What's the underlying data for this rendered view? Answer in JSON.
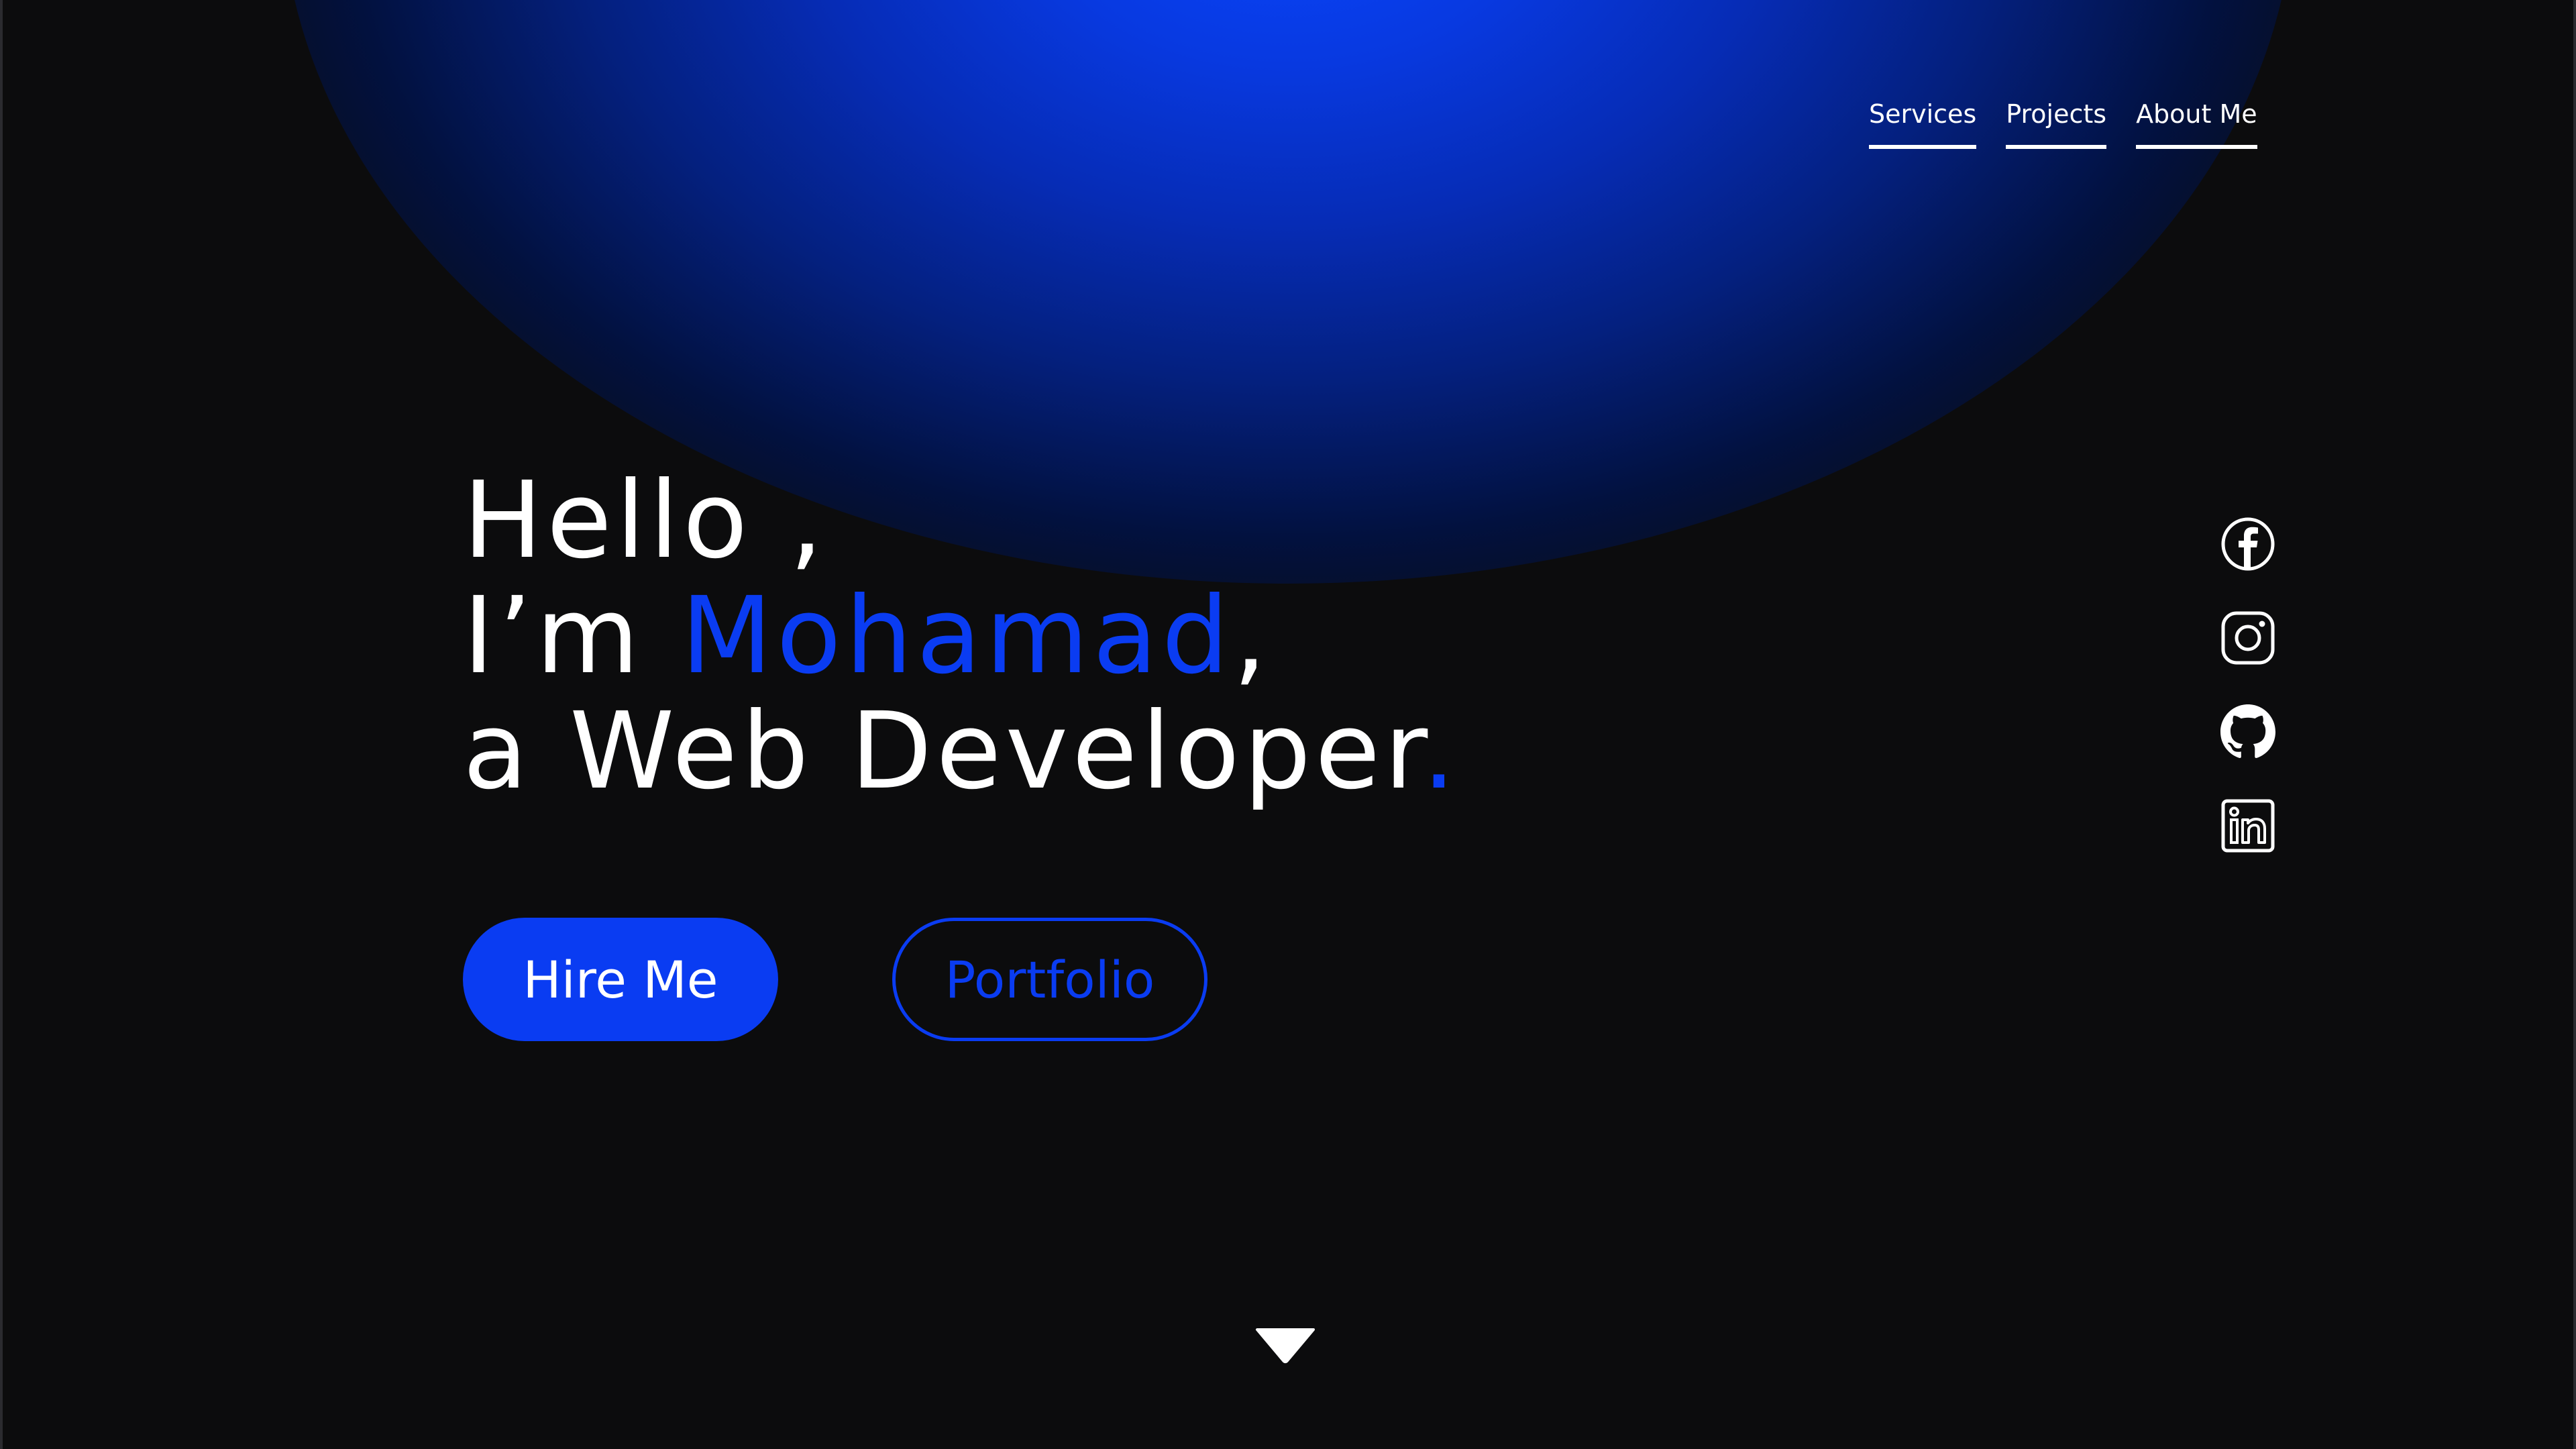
{
  "nav": {
    "items": [
      {
        "label": "Services"
      },
      {
        "label": "Projects"
      },
      {
        "label": "About Me"
      }
    ]
  },
  "hero": {
    "line1": "Hello ,",
    "line2_prefix": "I’m ",
    "line2_name": "Mohamad",
    "line2_suffix": ",",
    "line3_text": "a Web Developer",
    "line3_dot": "."
  },
  "buttons": {
    "primary_label": "Hire Me",
    "secondary_label": "Portfolio"
  },
  "socials": [
    {
      "icon": "facebook-icon"
    },
    {
      "icon": "instagram-icon"
    },
    {
      "icon": "github-icon"
    },
    {
      "icon": "linkedin-icon"
    }
  ],
  "scroll": {
    "icon": "scroll-down-arrow-icon"
  },
  "colors": {
    "background": "#0c0c0d",
    "accent": "#0a3cf2",
    "text": "#ffffff",
    "glow": "#0a46ff"
  }
}
